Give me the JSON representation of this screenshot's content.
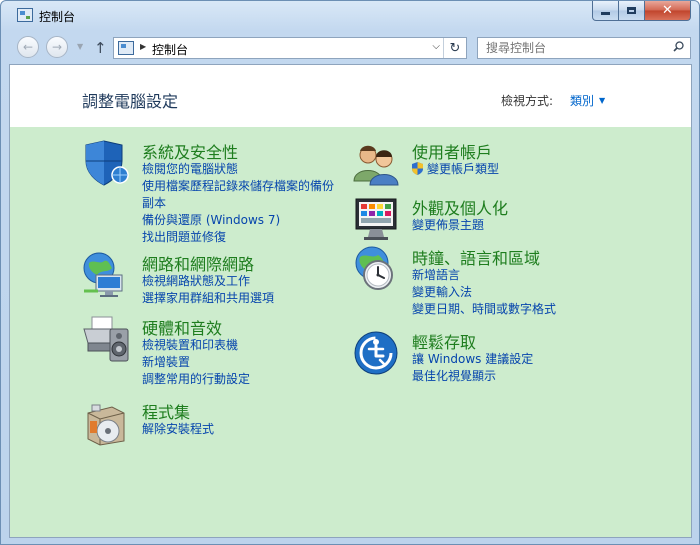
{
  "window": {
    "title": "控制台"
  },
  "nav": {
    "address_path": "控制台",
    "search_placeholder": "搜尋控制台"
  },
  "header": {
    "title": "調整電腦設定",
    "view_by_label": "檢視方式:",
    "view_by_value": "類別"
  },
  "categories_left": [
    {
      "title": "系統及安全性",
      "icon": "security-shield-icon",
      "links": [
        "檢閱您的電腦狀態",
        "使用檔案歷程記錄來儲存檔案的備份副本",
        "備份與還原 (Windows 7)",
        "找出問題並修復"
      ]
    },
    {
      "title": "網路和網際網路",
      "icon": "network-globe-icon",
      "links": [
        "檢視網路狀態及工作",
        "選擇家用群組和共用選項"
      ]
    },
    {
      "title": "硬體和音效",
      "icon": "printer-speaker-icon",
      "links": [
        "檢視裝置和印表機",
        "新增裝置",
        "調整常用的行動設定"
      ]
    },
    {
      "title": "程式集",
      "icon": "programs-disc-icon",
      "links": [
        "解除安裝程式"
      ]
    }
  ],
  "categories_right": [
    {
      "title": "使用者帳戶",
      "icon": "user-accounts-icon",
      "links": [
        "變更帳戶類型"
      ]
    },
    {
      "title": "外觀及個人化",
      "icon": "monitor-colors-icon",
      "links": [
        "變更佈景主題"
      ]
    },
    {
      "title": "時鐘、語言和區域",
      "icon": "clock-globe-icon",
      "links": [
        "新增語言",
        "變更輸入法",
        "變更日期、時間或數字格式"
      ]
    },
    {
      "title": "輕鬆存取",
      "icon": "ease-of-access-icon",
      "links": [
        "讓 Windows 建議設定",
        "最佳化視覺顯示"
      ]
    }
  ],
  "colors": {
    "category_title": "#1e7d1e",
    "link": "#0645ad",
    "panel_bg": "#cdeccd"
  }
}
